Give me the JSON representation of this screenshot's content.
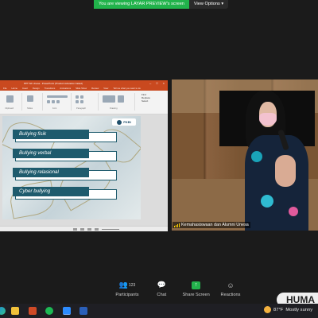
{
  "share_banner": {
    "message": "You are viewing LAYAR PREVIEW's screen",
    "view_options": "View Options"
  },
  "presentation": {
    "window_title": "PPT SK Unesa - PowerPoint (Product Activation Failed)",
    "tabs": [
      "File",
      "Home",
      "Insert",
      "Design",
      "Transitions",
      "Animations",
      "Slide Show",
      "Review",
      "View",
      "Tell me what you want to do"
    ],
    "ribbon_groups": [
      "Clipboard",
      "Slides",
      "Font",
      "Paragraph",
      "Drawing",
      "Editing"
    ],
    "ribbon_side": [
      "Find",
      "Replace",
      "Select"
    ],
    "slide": {
      "logo_text": "PKBI",
      "items": [
        "Bullying fisik",
        "Bullying verbal",
        "Bullying relasional",
        "Cyber bullying"
      ]
    }
  },
  "camera": {
    "participant_name": "Kemahasiswaan dan Alumni Unesa"
  },
  "toolbar": {
    "participants_label": "Participants",
    "participants_count": "123",
    "chat_label": "Chat",
    "share_label": "Share Screen",
    "reactions_label": "Reactions"
  },
  "taskbar": {
    "apps": [
      "edge",
      "file-explorer",
      "powerpoint-app",
      "spotify",
      "zoom",
      "word"
    ],
    "temperature": "87°F",
    "weather_text": "Mostly sunny"
  },
  "overlay": {
    "huma_text": "HUMA"
  }
}
